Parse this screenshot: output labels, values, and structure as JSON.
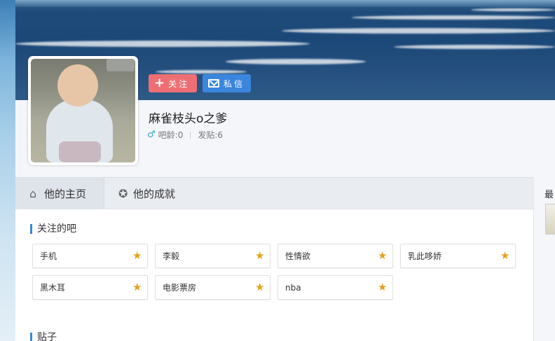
{
  "profile": {
    "username": "麻雀枝头o之爹",
    "gender_icon": "male-icon",
    "age_label": "吧龄:0",
    "posts_label": "发贴:6",
    "follow_label": "关注",
    "message_label": "私信"
  },
  "tabs": [
    {
      "label": "他的主页",
      "icon": "home-icon",
      "active": true
    },
    {
      "label": "他的成就",
      "icon": "medal-icon",
      "active": false
    }
  ],
  "followed_bars": {
    "title": "关注的吧",
    "items": [
      "手机",
      "李毅",
      "性情欲",
      "乳此哆娇",
      "黑木耳",
      "电影票房",
      "nba"
    ]
  },
  "posts": {
    "title": "贴子"
  },
  "sidebar": {
    "title": "最"
  },
  "colors": {
    "follow_button": "#ee6f73",
    "message_button": "#3b86dd",
    "accent": "#3b86dd",
    "star": "#e1a21a"
  }
}
